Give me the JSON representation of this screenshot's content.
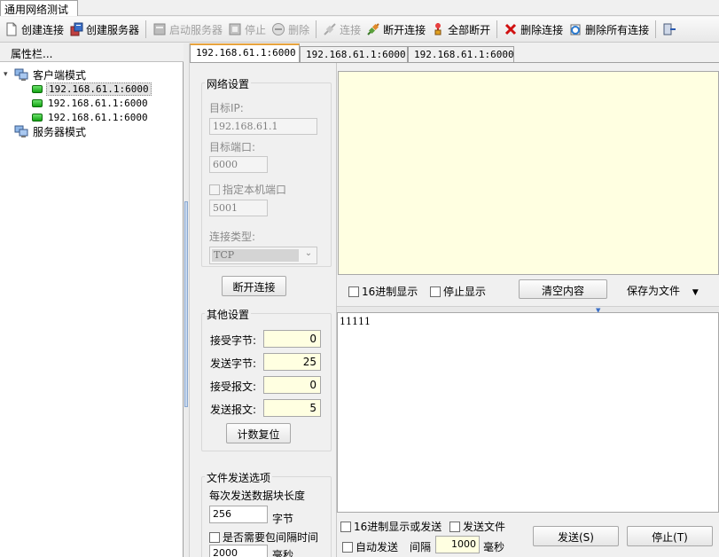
{
  "window": {
    "title_tab": "通用网络测试"
  },
  "toolbar": {
    "buttons": [
      {
        "label": "创建连接",
        "icon": "new-document-icon",
        "enabled": true
      },
      {
        "label": "创建服务器",
        "icon": "server-create-icon",
        "enabled": true
      },
      {
        "label": "启动服务器",
        "icon": "server-start-icon",
        "enabled": false
      },
      {
        "label": "停止",
        "icon": "stop-icon",
        "enabled": false
      },
      {
        "label": "删除",
        "icon": "delete-circle-icon",
        "enabled": false
      },
      {
        "label": "连接",
        "icon": "plug-connect-icon",
        "enabled": false
      },
      {
        "label": "断开连接",
        "icon": "plug-disconnect-icon",
        "enabled": true
      },
      {
        "label": "全部断开",
        "icon": "disconnect-all-icon",
        "enabled": true
      },
      {
        "label": "删除连接",
        "icon": "red-x-icon",
        "enabled": true
      },
      {
        "label": "删除所有连接",
        "icon": "delete-all-icon",
        "enabled": true
      }
    ]
  },
  "left_panel": {
    "header": "属性栏...",
    "tree": {
      "client_mode": "客户端模式",
      "connections": [
        "192.168.61.1:6000",
        "192.168.61.1:6000",
        "192.168.61.1:6000"
      ],
      "server_mode": "服务器模式"
    }
  },
  "tabs": [
    "192.168.61.1:6000",
    "192.168.61.1:6000",
    "192.168.61.1:6000"
  ],
  "network_settings": {
    "title": "网络设置",
    "target_ip_label": "目标IP:",
    "target_ip": "192.168.61.1",
    "target_port_label": "目标端口:",
    "target_port": "6000",
    "local_port_label": "指定本机端口",
    "local_port": "5001",
    "conn_type_label": "连接类型:",
    "conn_type": "TCP",
    "disconnect_button": "断开连接"
  },
  "other_settings": {
    "title": "其他设置",
    "recv_bytes_label": "接受字节:",
    "recv_bytes": "0",
    "send_bytes_label": "发送字节:",
    "send_bytes": "25",
    "recv_msgs_label": "接受报文:",
    "recv_msgs": "0",
    "send_msgs_label": "发送报文:",
    "send_msgs": "5",
    "reset_button": "计数复位"
  },
  "file_send": {
    "title": "文件发送选项",
    "chunk_label": "每次发送数据块长度",
    "chunk_value": "256",
    "chunk_unit": "字节",
    "interval_check_label": "是否需要包间隔时间",
    "interval_value": "2000",
    "interval_unit": "毫秒"
  },
  "receive_bar": {
    "hex_display": "16进制显示",
    "stop_display": "停止显示",
    "clear_button": "清空内容",
    "save_button": "保存为文件"
  },
  "send": {
    "content": "11111",
    "hex_label": "16进制显示或发送",
    "send_file_label": "发送文件",
    "auto_send_label": "自动发送",
    "interval_label": "间隔",
    "interval_value": "1000",
    "interval_unit": "毫秒",
    "send_button": "发送(S)",
    "stop_button": "停止(T)"
  }
}
